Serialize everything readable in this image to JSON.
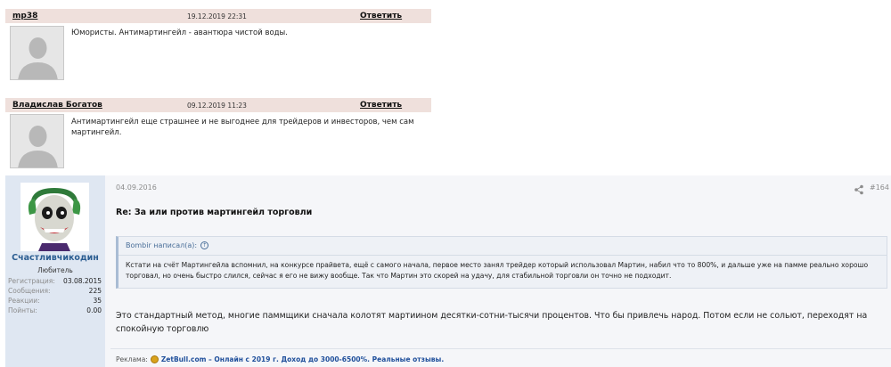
{
  "comments": [
    {
      "author": "mp38",
      "date": "19.12.2019 22:31",
      "reply": "Ответить",
      "text": "Юмористы. Антимартингейл - авантюра чистой воды."
    },
    {
      "author": "Владислав Богатов",
      "date": "09.12.2019 11:23",
      "reply": "Ответить",
      "text": "Антимартингейл еще страшнее и не выгоднее для трейдеров и инвесторов, чем сам мартингейл."
    }
  ],
  "post": {
    "user": {
      "name": "Счастливчикодин",
      "title": "Любитель",
      "stats": [
        {
          "label": "Регистрация:",
          "value": "03.08.2015"
        },
        {
          "label": "Сообщения:",
          "value": "225"
        },
        {
          "label": "Реакции:",
          "value": "35"
        },
        {
          "label": "Пойнты:",
          "value": "0.00"
        }
      ]
    },
    "date": "04.09.2016",
    "number": "#164",
    "title": "Re: За или против мартингейл торговли",
    "quote": {
      "author": "Bombir написал(а):",
      "text": "Кстати на счёт Мартингейла вспомнил, на конкурсе прайвета, ещё с самого начала, первое место занял трейдер который использовал Мартин, набил что то 800%, и дальше уже на памме реально хорошо торговал, но очень быстро слился, сейчас я его не вижу вообще. Так что Мартин это скорей на удачу, для стабильной торговли он точно не подходит."
    },
    "body": "Это стандартный метод, многие паммщики сначала колотят мартиином десятки-сотни-тысячи процентов. Что бы привлечь народ. Потом если не сольют, переходят на спокойную торговлю",
    "ad": {
      "label": "Реклама:",
      "link": "ZetBull.com – Онлайн с 2019 г. Доход до 3000-6500%. Реальные отзывы."
    }
  }
}
